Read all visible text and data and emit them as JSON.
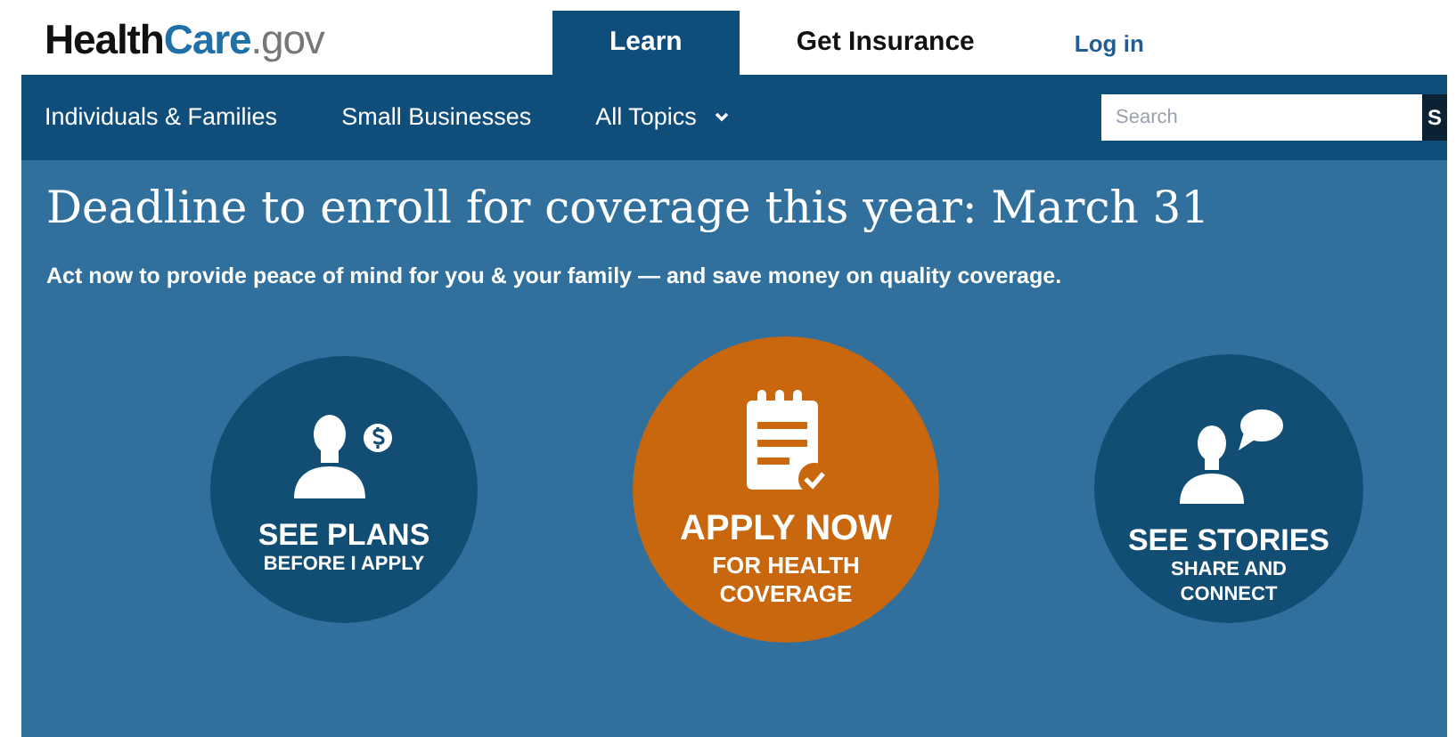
{
  "logo": [
    "Health",
    "Care",
    ".gov"
  ],
  "header_tabs": [
    {
      "label": "Learn",
      "selected": true
    },
    {
      "label": "Get Insurance",
      "selected": false
    }
  ],
  "login_link": "Log in",
  "nav_items": [
    {
      "label": "Individuals & Families",
      "kind": "link"
    },
    {
      "label": "Small Businesses",
      "kind": "link"
    },
    {
      "label": "All Topics",
      "kind": "dropdown"
    }
  ],
  "search": {
    "placeholder": "Search",
    "button": "S"
  },
  "headline": "Deadline to enroll for coverage this year: March 31",
  "subheadline": "Act now to provide peace of mind for you & your family — and save money on quality coverage.",
  "actions": [
    {
      "kind": "plans",
      "title": "SEE PLANS",
      "subtitle": "BEFORE I APPLY",
      "color": "#124d74"
    },
    {
      "kind": "apply",
      "title": "APPLY NOW",
      "subtitle": "FOR HEALTH COVERAGE",
      "color": "#c8670e"
    },
    {
      "kind": "stories",
      "title": "SEE STORIES",
      "subtitle": "SHARE AND CONNECT",
      "color": "#124d74"
    }
  ]
}
